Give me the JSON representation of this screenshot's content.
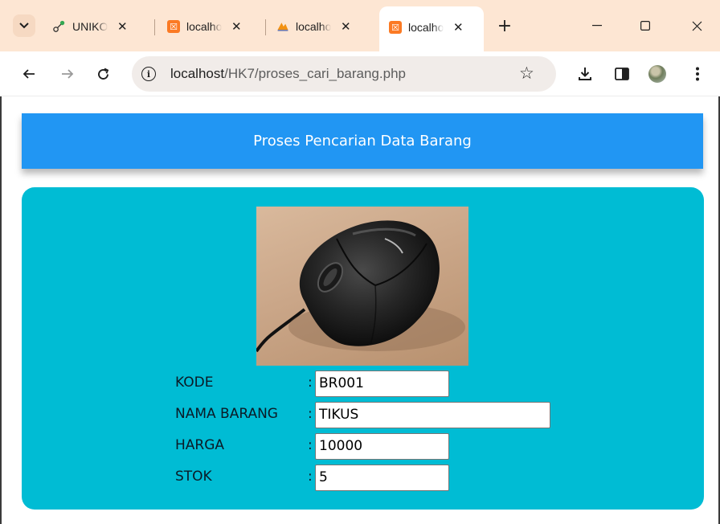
{
  "browser": {
    "tabs": [
      {
        "title": "UNIKOM",
        "favicon": "network-icon",
        "active": false
      },
      {
        "title": "localhost",
        "favicon": "xampp-icon",
        "active": false
      },
      {
        "title": "localhost",
        "favicon": "phpmyadmin-icon",
        "active": false
      },
      {
        "title": "localhost",
        "favicon": "xampp-icon",
        "active": true
      }
    ],
    "url_host": "localhost",
    "url_path": "/HK7/proses_cari_barang.php"
  },
  "page": {
    "header_title": "Proses Pencarian Data Barang",
    "product_image": "computer-mouse",
    "form": {
      "colon": ":",
      "fields": [
        {
          "label": "KODE",
          "value": "BR001"
        },
        {
          "label": "NAMA BARANG",
          "value": "TIKUS"
        },
        {
          "label": "HARGA",
          "value": "10000"
        },
        {
          "label": "STOK",
          "value": "5"
        }
      ]
    }
  },
  "colors": {
    "tabstrip_bg": "#fde6d3",
    "header_bg": "#2196f3",
    "card_bg": "#00bcd4"
  }
}
